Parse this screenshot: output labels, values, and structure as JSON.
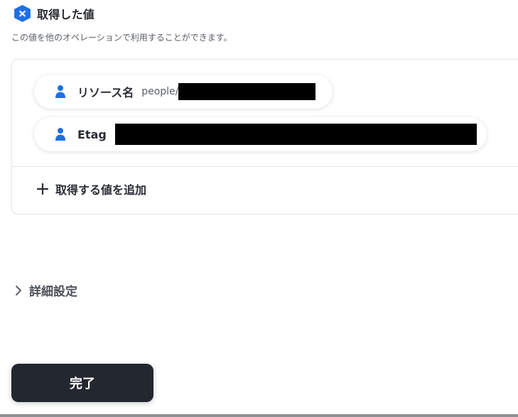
{
  "header": {
    "icon": "yoom-hex-icon",
    "title": "取得した値",
    "description": "この値を他のオペレーションで利用することができます。"
  },
  "fields": [
    {
      "icon": "person-icon",
      "name": "リソース名",
      "value": "people/",
      "redacted": true
    },
    {
      "icon": "person-icon",
      "name": "Etag",
      "value": "",
      "redacted": true
    }
  ],
  "add_value": {
    "icon": "plus-icon",
    "label": "取得する値を追加"
  },
  "advanced": {
    "icon": "chevron-right-icon",
    "label": "詳細設定"
  },
  "done_button": {
    "label": "完了"
  },
  "colors": {
    "accent": "#1e6fe8",
    "button_bg": "#23272f",
    "border": "#e3e5e8",
    "redaction": "#000000"
  }
}
